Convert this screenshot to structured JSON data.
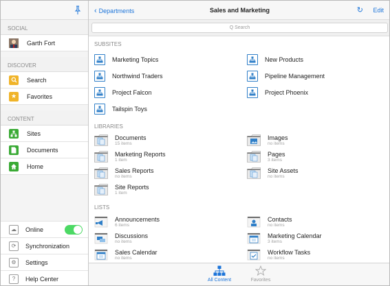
{
  "sidebar": {
    "sections": [
      {
        "label": "SOCIAL",
        "items": [
          {
            "label": "Garth Fort",
            "icon": "user-avatar-icon"
          }
        ]
      },
      {
        "label": "DISCOVER",
        "items": [
          {
            "label": "Search",
            "icon": "search-icon",
            "color": "#f0b429"
          },
          {
            "label": "Favorites",
            "icon": "star-icon",
            "color": "#f0b429"
          }
        ]
      },
      {
        "label": "CONTENT",
        "items": [
          {
            "label": "Sites",
            "icon": "sites-icon",
            "color": "#3aaa35"
          },
          {
            "label": "Documents",
            "icon": "document-icon",
            "color": "#3aaa35"
          },
          {
            "label": "Home",
            "icon": "home-icon",
            "color": "#3aaa35"
          }
        ]
      }
    ],
    "bottom": [
      {
        "label": "Online",
        "icon": "cloud-icon",
        "toggle": true
      },
      {
        "label": "Synchronization",
        "icon": "sync-icon"
      },
      {
        "label": "Settings",
        "icon": "gear-icon"
      },
      {
        "label": "Help Center",
        "icon": "help-icon"
      }
    ]
  },
  "header": {
    "back_label": "Departments",
    "title": "Sales and Marketing",
    "edit_label": "Edit"
  },
  "search": {
    "placeholder": "Q Search"
  },
  "subsites": {
    "label": "SUBSITES",
    "items": [
      "Marketing Topics",
      "New Products",
      "Northwind Traders",
      "Pipeline Management",
      "Project Falcon",
      "Project Phoenix",
      "Tailspin Toys"
    ]
  },
  "libraries": {
    "label": "LIBRARIES",
    "items": [
      {
        "name": "Documents",
        "count": "15 items",
        "icon": "document-library-icon"
      },
      {
        "name": "Images",
        "count": "no items",
        "icon": "image-library-icon"
      },
      {
        "name": "Marketing Reports",
        "count": "1 item",
        "icon": "document-library-icon"
      },
      {
        "name": "Pages",
        "count": "3 items",
        "icon": "document-library-icon"
      },
      {
        "name": "Sales Reports",
        "count": "no items",
        "icon": "document-library-icon"
      },
      {
        "name": "Site Assets",
        "count": "no items",
        "icon": "document-library-icon"
      },
      {
        "name": "Site Reports",
        "count": "1 item",
        "icon": "document-library-icon"
      }
    ]
  },
  "lists": {
    "label": "LISTS",
    "items": [
      {
        "name": "Announcements",
        "count": "6 items",
        "icon": "megaphone-icon"
      },
      {
        "name": "Contacts",
        "count": "no items",
        "icon": "contact-icon"
      },
      {
        "name": "Discussions",
        "count": "no items",
        "icon": "discussion-icon"
      },
      {
        "name": "Marketing Calendar",
        "count": "3 items",
        "icon": "calendar-icon"
      },
      {
        "name": "Sales Calendar",
        "count": "no items",
        "icon": "calendar-icon"
      },
      {
        "name": "Workflow Tasks",
        "count": "no items",
        "icon": "task-icon"
      }
    ]
  },
  "tabs": [
    {
      "label": "All Content",
      "active": true
    },
    {
      "label": "Favorites",
      "active": false
    }
  ],
  "colors": {
    "accent": "#1a73d9",
    "toggle_on": "#4cd964",
    "site_icon": "#2f7fc8"
  }
}
